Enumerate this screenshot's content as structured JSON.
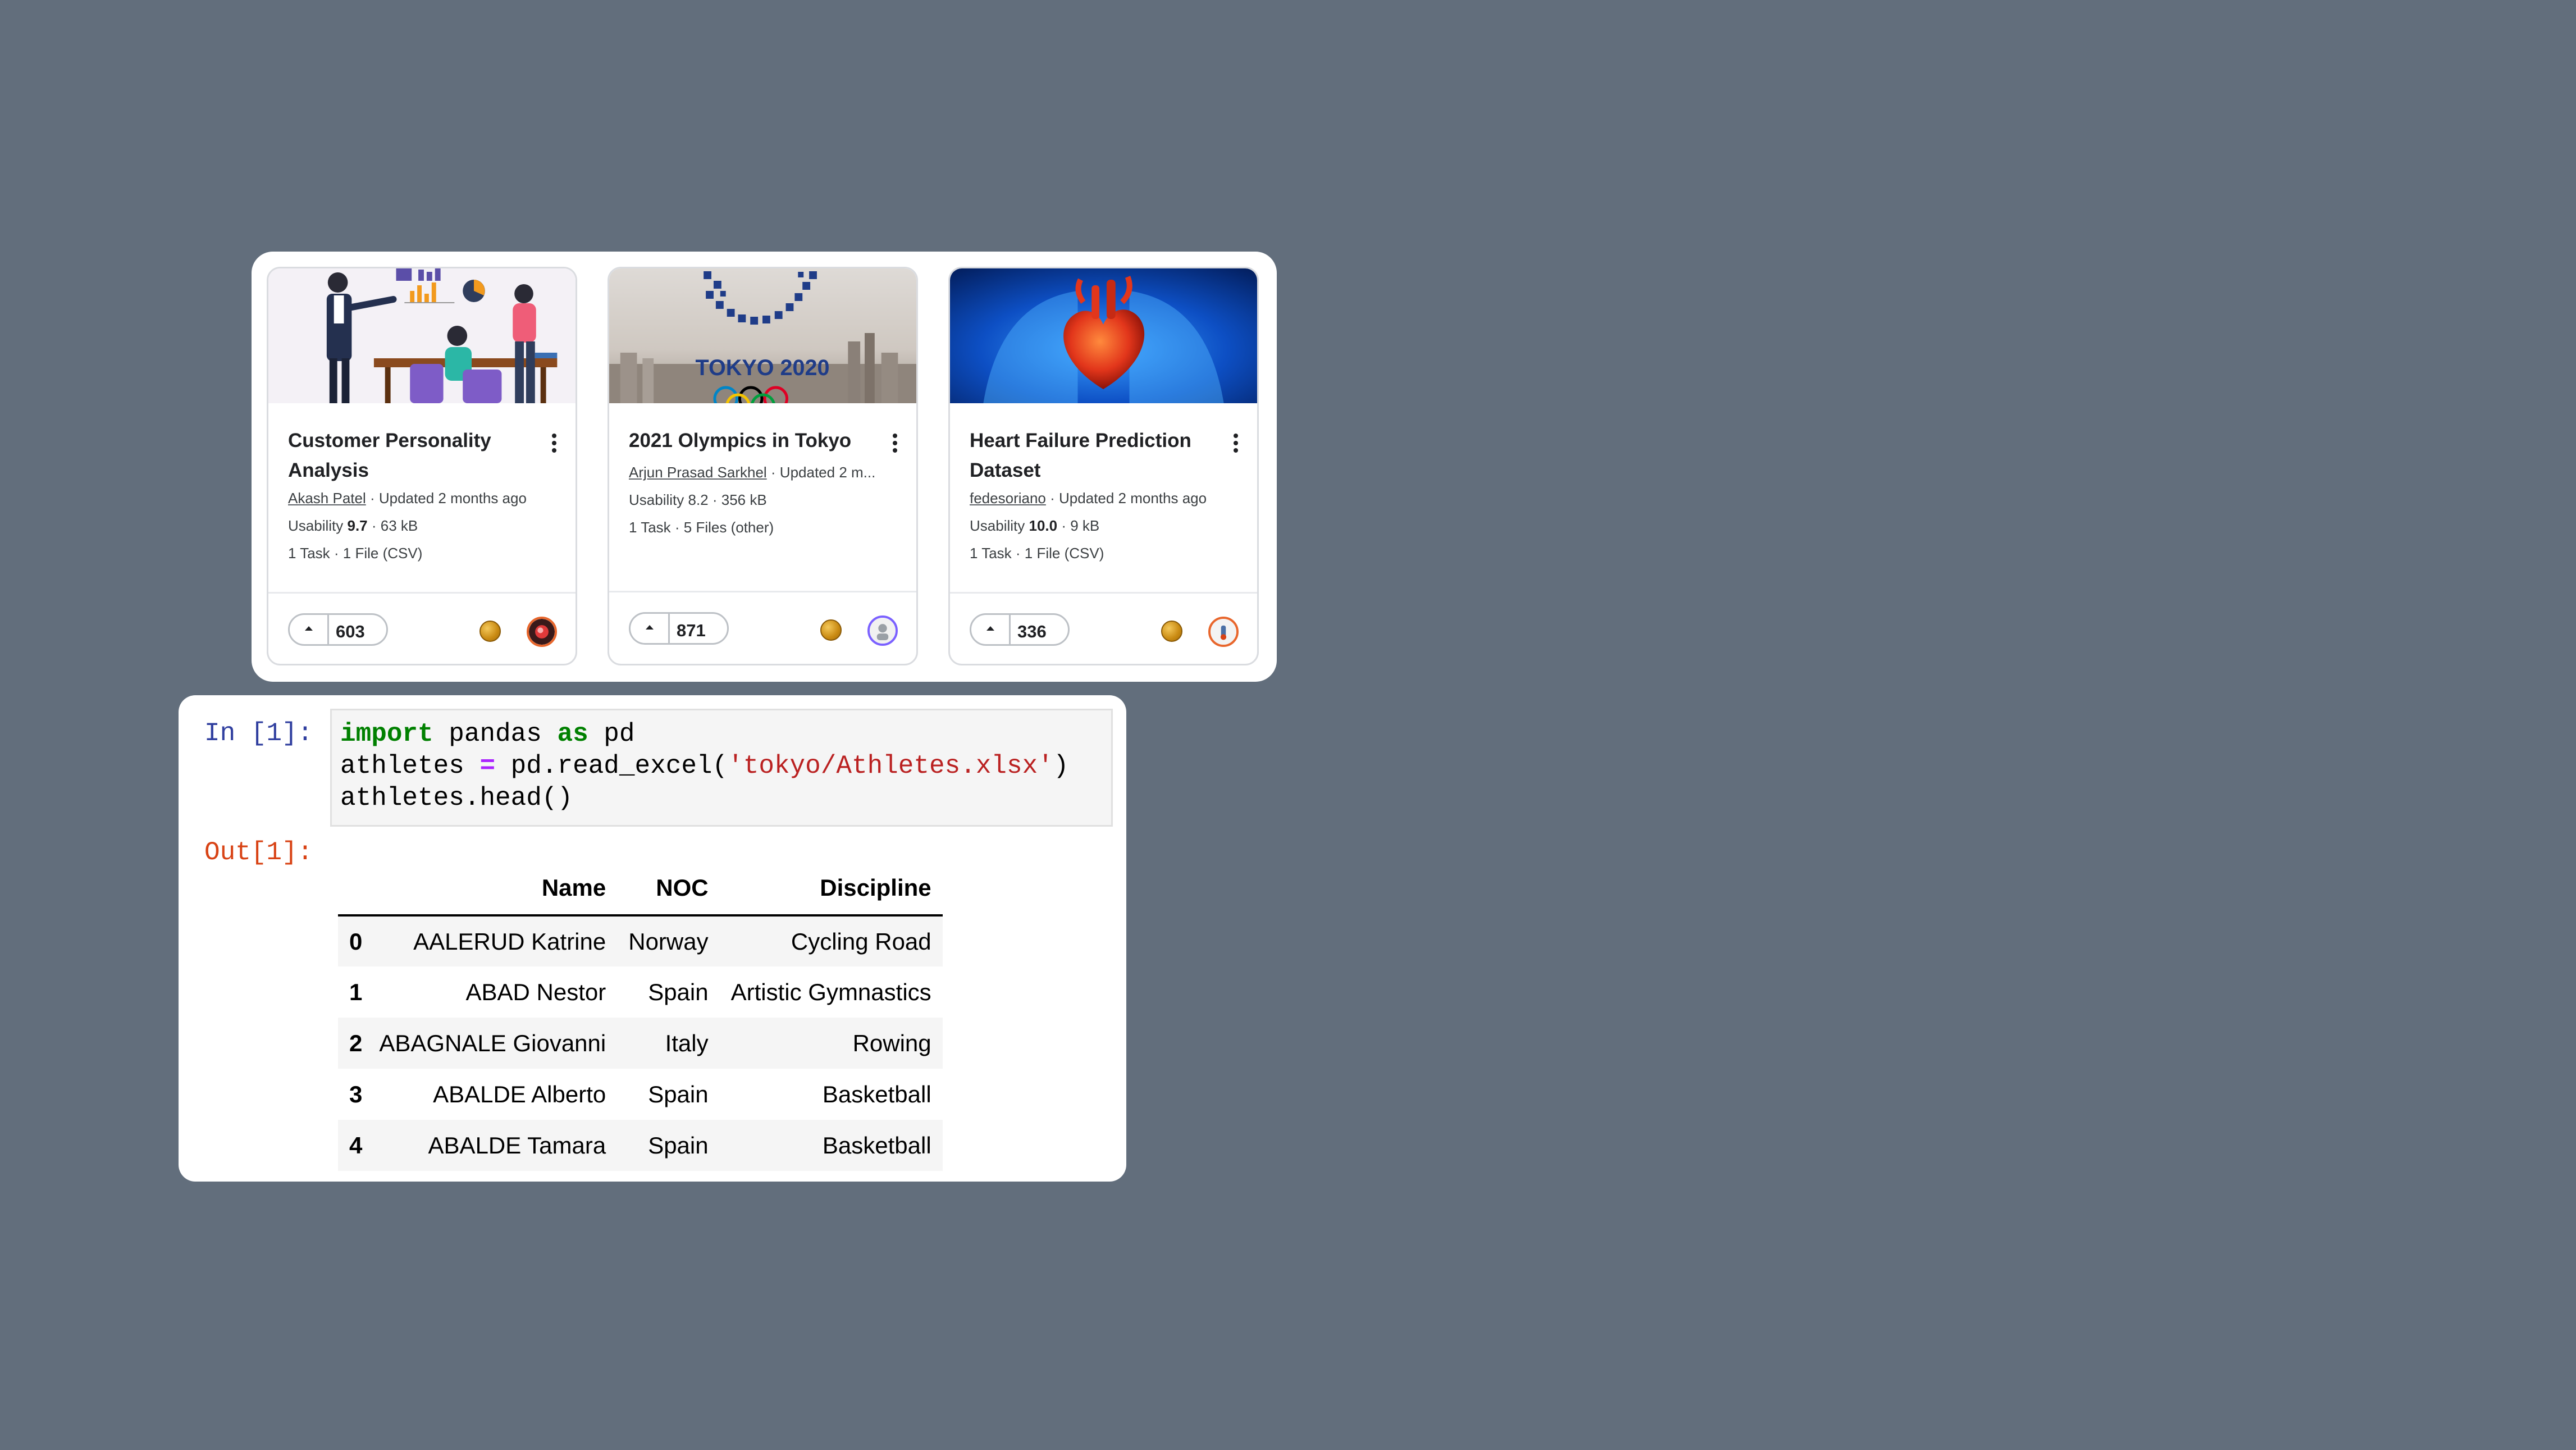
{
  "datasets": [
    {
      "title": "Customer Personality Analysis",
      "author": "Akash Patel",
      "updated": " · Updated 2 months ago",
      "usability_label": "Usability ",
      "usability": "9.7",
      "size": " · 63 kB",
      "files": "1 Task · 1 File (CSV)",
      "votes": "603"
    },
    {
      "title": "2021 Olympics in Tokyo",
      "author": "Arjun Prasad Sarkhel",
      "updated": " · Updated 2 m...",
      "usability_label": "Usability ",
      "usability": "8.2",
      "size": " · 356 kB",
      "files": "1 Task · 5 Files (other)",
      "votes": "871",
      "thumb_text": "TOKYO 2020"
    },
    {
      "title": "Heart Failure Prediction Dataset",
      "author": "fedesoriano",
      "updated": " · Updated 2 months ago",
      "usability_label": "Usability ",
      "usability": "10.0",
      "size": " · 9 kB",
      "files": "1 Task · 1 File (CSV)",
      "votes": "336"
    }
  ],
  "notebook": {
    "in_prompt": "In [1]:",
    "out_prompt": "Out[1]:",
    "code": {
      "l1_kw1": "import",
      "l1_mid": " pandas ",
      "l1_kw2": "as",
      "l1_end": " pd",
      "l2_a": "athletes ",
      "l2_op": "=",
      "l2_b": " pd.read_excel(",
      "l2_str": "'tokyo/Athletes.xlsx'",
      "l2_c": ")",
      "l3": "athletes.head()"
    },
    "table": {
      "columns": [
        "Name",
        "NOC",
        "Discipline"
      ],
      "rows": [
        {
          "index": "0",
          "name": "AALERUD Katrine",
          "noc": "Norway",
          "discipline": "Cycling Road"
        },
        {
          "index": "1",
          "name": "ABAD Nestor",
          "noc": "Spain",
          "discipline": "Artistic Gymnastics"
        },
        {
          "index": "2",
          "name": "ABAGNALE Giovanni",
          "noc": "Italy",
          "discipline": "Rowing"
        },
        {
          "index": "3",
          "name": "ABALDE Alberto",
          "noc": "Spain",
          "discipline": "Basketball"
        },
        {
          "index": "4",
          "name": "ABALDE Tamara",
          "noc": "Spain",
          "discipline": "Basketball"
        }
      ]
    }
  },
  "colors": {
    "background": "#626e7c",
    "in_prompt": "#303f9f",
    "out_prompt": "#d84315",
    "keyword": "#008000",
    "string": "#ba2121"
  }
}
